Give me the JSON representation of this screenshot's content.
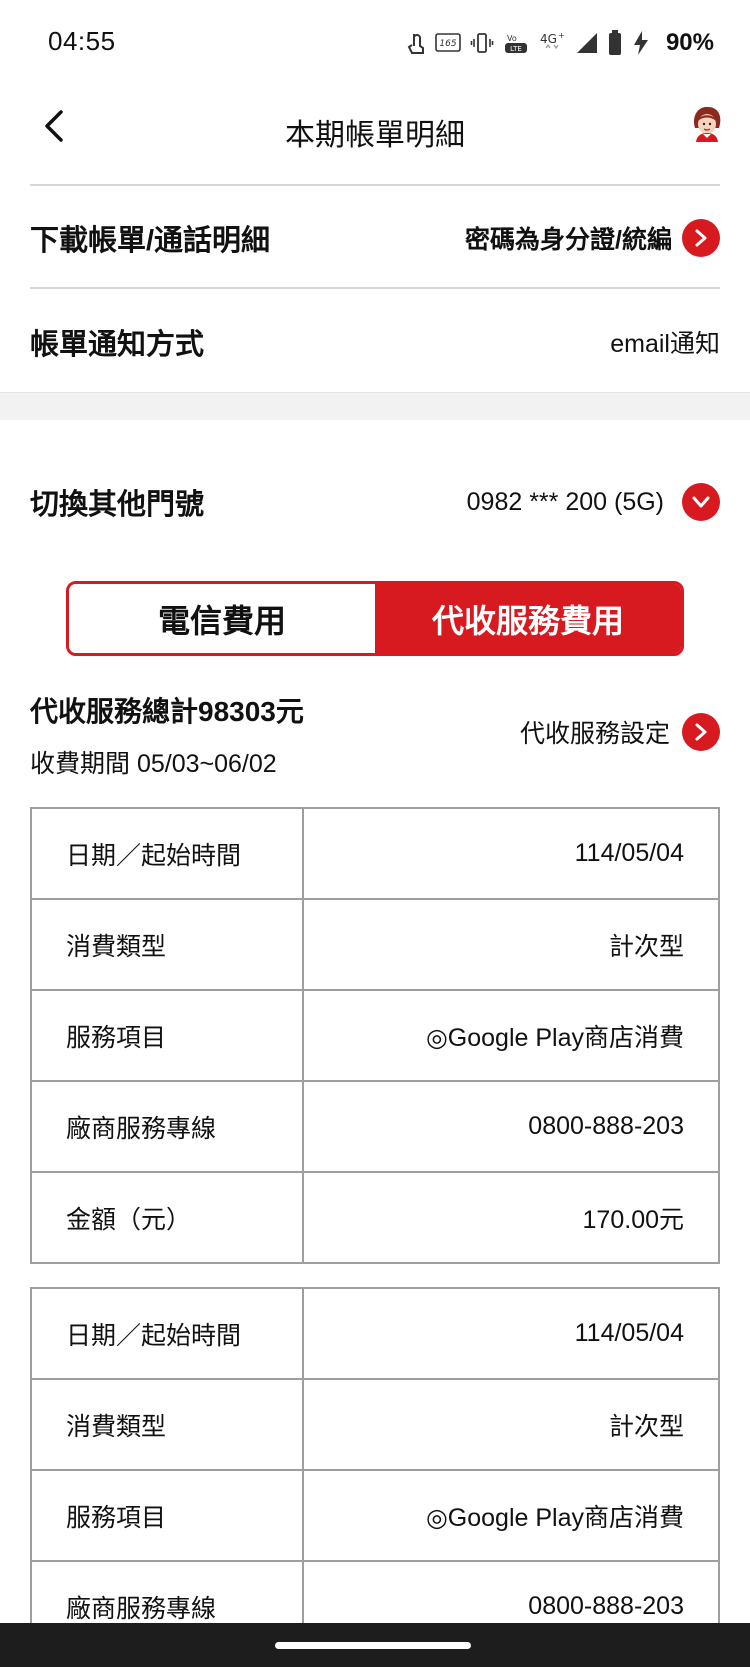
{
  "status_bar": {
    "time": "04:55",
    "battery": "90%",
    "icons": [
      "touch-icon",
      "refresh-rate-165hz-icon",
      "vibrate-icon",
      "volte-icon",
      "4g-plus-icon",
      "signal-icon",
      "battery-icon",
      "charging-icon"
    ]
  },
  "header": {
    "title": "本期帳單明細"
  },
  "rows": {
    "download": {
      "label": "下載帳單/通話明細",
      "value": "密碼為身分證/統編"
    },
    "notify": {
      "label": "帳單通知方式",
      "value": "email通知"
    },
    "switch": {
      "label": "切換其他門號",
      "value": "0982 *** 200 (5G)"
    }
  },
  "tabs": {
    "telecom": "電信費用",
    "collection": "代收服務費用"
  },
  "summary": {
    "title": "代收服務總計98303元",
    "period": "收費期間 05/03~06/02",
    "setting": "代收服務設定"
  },
  "records": [
    {
      "date_label": "日期／起始時間",
      "date_value": "114/05/04",
      "type_label": "消費類型",
      "type_value": "計次型",
      "item_label": "服務項目",
      "item_value": "◎Google Play商店消費",
      "hotline_label": "廠商服務專線",
      "hotline_value": "0800-888-203",
      "amount_label": "金額（元）",
      "amount_value": "170.00元"
    },
    {
      "date_label": "日期／起始時間",
      "date_value": "114/05/04",
      "type_label": "消費類型",
      "type_value": "計次型",
      "item_label": "服務項目",
      "item_value": "◎Google Play商店消費",
      "hotline_label": "廠商服務專線",
      "hotline_value": "0800-888-203"
    }
  ],
  "colors": {
    "accent": "#d71920",
    "divider": "#d6d6d6",
    "table_border": "#9e9e9e",
    "nav_bar": "#1d1d1d"
  }
}
